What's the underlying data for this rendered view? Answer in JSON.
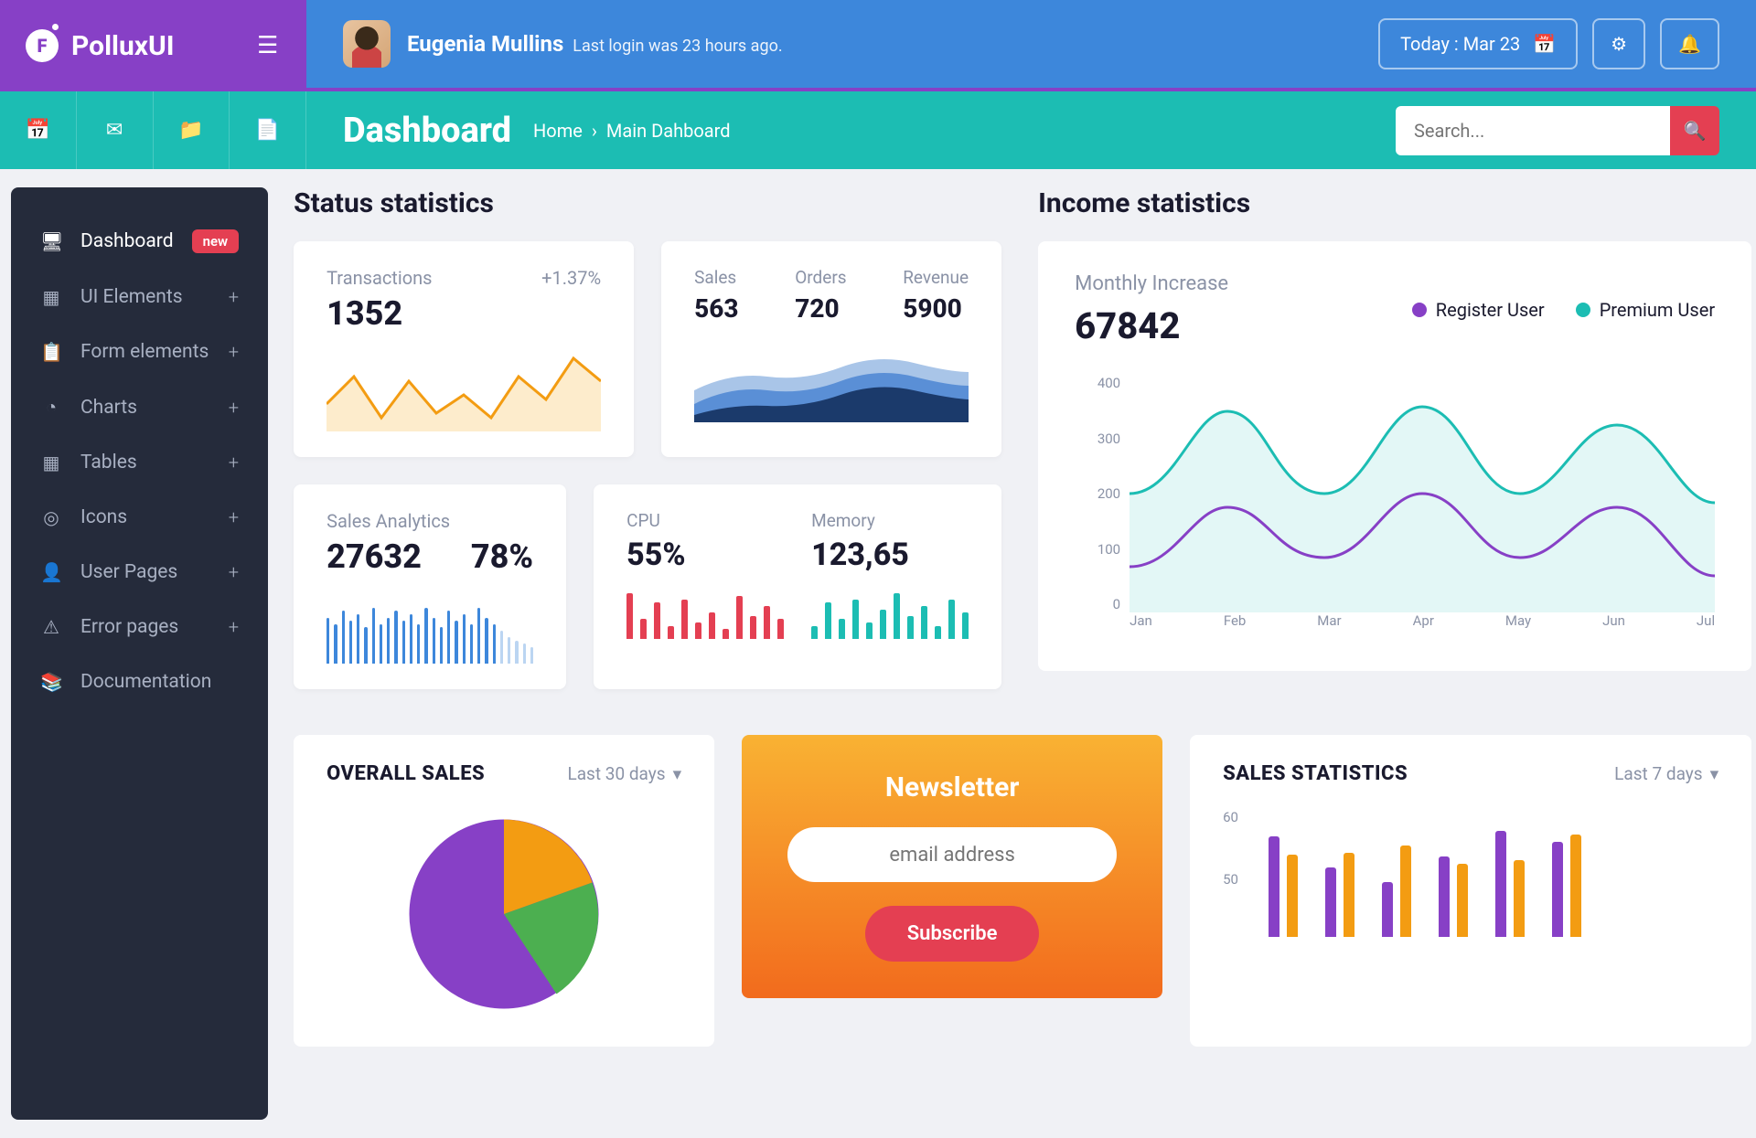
{
  "brand": "PolluxUI",
  "user": {
    "name": "Eugenia Mullins",
    "sub": "Last login was 23 hours ago."
  },
  "header": {
    "today": "Today : Mar 23"
  },
  "toolbar": {
    "title": "Dashboard",
    "breadcrumb_home": "Home",
    "breadcrumb_sep": "›",
    "breadcrumb_current": "Main Dahboard",
    "search_placeholder": "Search..."
  },
  "sidebar": {
    "items": [
      {
        "label": "Dashboard",
        "badge": "new"
      },
      {
        "label": "UI Elements"
      },
      {
        "label": "Form elements"
      },
      {
        "label": "Charts"
      },
      {
        "label": "Tables"
      },
      {
        "label": "Icons"
      },
      {
        "label": "User Pages"
      },
      {
        "label": "Error pages"
      },
      {
        "label": "Documentation"
      }
    ]
  },
  "sections": {
    "status": "Status statistics",
    "income": "Income statistics"
  },
  "cards": {
    "transactions": {
      "label": "Transactions",
      "value": "1352",
      "pct": "+1.37%"
    },
    "sor": {
      "sales_l": "Sales",
      "sales_v": "563",
      "orders_l": "Orders",
      "orders_v": "720",
      "rev_l": "Revenue",
      "rev_v": "5900"
    },
    "analytics": {
      "label": "Sales Analytics",
      "v1": "27632",
      "v2": "78%"
    },
    "sys": {
      "cpu_l": "CPU",
      "cpu_v": "55%",
      "mem_l": "Memory",
      "mem_v": "123,65"
    }
  },
  "income": {
    "title": "Monthly Increase",
    "value": "67842",
    "legend": {
      "a": "Register User",
      "b": "Premium User"
    },
    "yticks": [
      "400",
      "300",
      "200",
      "100",
      "0"
    ],
    "xticks": [
      "Jan",
      "Feb",
      "Mar",
      "Apr",
      "May",
      "Jun",
      "Jul"
    ]
  },
  "overall": {
    "title": "OVERALL SALES",
    "range": "Last 30 days"
  },
  "newsletter": {
    "title": "Newsletter",
    "placeholder": "email address",
    "btn": "Subscribe"
  },
  "stats": {
    "title": "SALES STATISTICS",
    "range": "Last 7 days",
    "yticks": [
      "60",
      "50"
    ]
  },
  "chart_data": [
    {
      "type": "area",
      "title": "Transactions sparkline",
      "series": [
        {
          "name": "transactions",
          "values": [
            35,
            60,
            20,
            55,
            25,
            40,
            20,
            60,
            35,
            80
          ]
        }
      ]
    },
    {
      "type": "area",
      "title": "Sales/Orders/Revenue stacked",
      "series": [
        {
          "name": "light",
          "values": [
            40,
            55,
            60,
            50,
            65,
            50,
            70,
            60
          ]
        },
        {
          "name": "mid",
          "values": [
            25,
            35,
            45,
            35,
            50,
            40,
            55,
            45
          ]
        },
        {
          "name": "dark",
          "values": [
            10,
            18,
            30,
            22,
            35,
            28,
            40,
            30
          ]
        }
      ]
    },
    {
      "type": "bar",
      "title": "Sales Analytics bars",
      "values": [
        70,
        60,
        80,
        65,
        75,
        55,
        85,
        60,
        70,
        80,
        65,
        75,
        60,
        85,
        70,
        55,
        80,
        65,
        75,
        60,
        85,
        70,
        60,
        50,
        40,
        35,
        30,
        25
      ]
    },
    {
      "type": "bar",
      "title": "CPU bars",
      "values": [
        70,
        30,
        55,
        20,
        60,
        25,
        40,
        15,
        65,
        35,
        50,
        30
      ]
    },
    {
      "type": "bar",
      "title": "Memory bars",
      "values": [
        20,
        55,
        30,
        60,
        25,
        45,
        70,
        35,
        50,
        20,
        60,
        40
      ]
    },
    {
      "type": "line",
      "title": "Monthly Increase",
      "x": [
        "Jan",
        "Feb",
        "Mar",
        "Apr",
        "May",
        "Jun",
        "Jul"
      ],
      "ylim": [
        0,
        400
      ],
      "series": [
        {
          "name": "Premium User",
          "values": [
            200,
            330,
            200,
            340,
            200,
            300,
            190
          ]
        },
        {
          "name": "Register User",
          "values": [
            80,
            180,
            100,
            200,
            100,
            180,
            70
          ]
        }
      ]
    },
    {
      "type": "pie",
      "title": "Overall Sales",
      "series": [
        {
          "name": "purple",
          "value": 55
        },
        {
          "name": "orange",
          "value": 20
        },
        {
          "name": "green",
          "value": 25
        }
      ]
    },
    {
      "type": "bar",
      "title": "Sales Statistics",
      "values": [
        [
          55,
          45
        ],
        [
          38,
          46
        ],
        [
          30,
          50
        ],
        [
          44,
          40
        ],
        [
          58,
          42
        ],
        [
          52,
          56
        ]
      ]
    }
  ]
}
